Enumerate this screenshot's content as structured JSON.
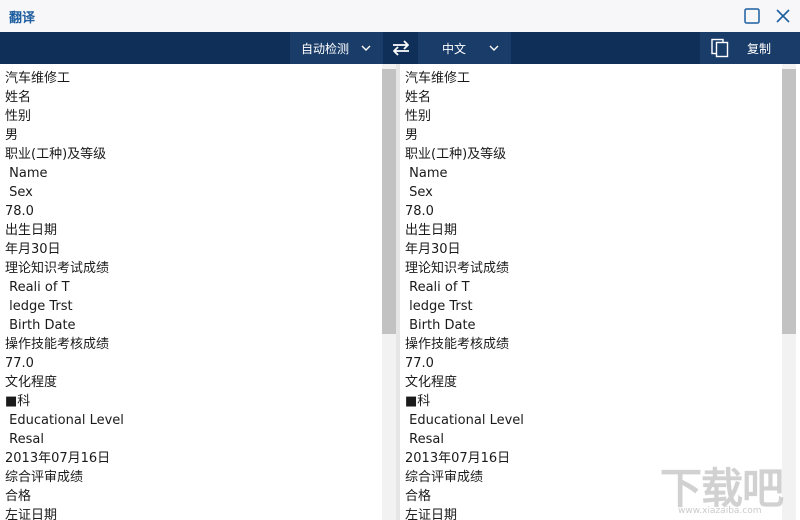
{
  "window": {
    "title": "翻译"
  },
  "toolbar": {
    "source_language": "自动检测",
    "target_language": "中文",
    "copy_label": "复制"
  },
  "source_pane": {
    "lines": [
      "汽车维修工",
      "姓名",
      "性别",
      "男",
      "职业(工种)及等级",
      " Name",
      " Sex",
      "78.0",
      "出生日期",
      "年月30日",
      "理论知识考试成绩",
      " Reali of T",
      " ledge Trst",
      " Birth Date",
      "操作技能考核成绩",
      "77.0",
      "文化程度",
      "■科",
      " Educational Level",
      " Resal",
      "2013年07月16日",
      "综合评审成绩",
      "合格",
      "左证日期"
    ]
  },
  "target_pane": {
    "lines": [
      "汽车维修工",
      "姓名",
      "性别",
      "男",
      "职业(工种)及等级",
      " Name",
      " Sex",
      "78.0",
      "出生日期",
      "年月30日",
      "理论知识考试成绩",
      " Reali of T",
      " ledge Trst",
      " Birth Date",
      "操作技能考核成绩",
      "77.0",
      "文化程度",
      "■科",
      " Educational Level",
      " Resal",
      "2013年07月16日",
      "综合评审成绩",
      "合格",
      "左证日期"
    ]
  },
  "watermark": {
    "text": "下载吧",
    "url": "www.xiazaiba.com"
  },
  "colors": {
    "title_text": "#1f5fa0",
    "toolbar_bg": "#0f2f58",
    "select_bg": "#1a3c69",
    "scroll_thumb": "#c2c2c2"
  },
  "icons": {
    "maximize": "square-outline-icon",
    "close": "close-x-icon",
    "swap": "swap-arrows-icon",
    "copy": "copy-pages-icon",
    "dropdown": "chevron-down-icon"
  }
}
